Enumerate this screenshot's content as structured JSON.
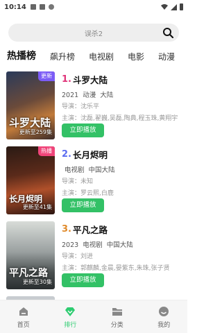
{
  "status": {
    "time": "10:14"
  },
  "search": {
    "placeholder": "误杀2"
  },
  "tabs": [
    "热播榜",
    "飙升榜",
    "电视剧",
    "电影",
    "动漫",
    "综"
  ],
  "items": [
    {
      "rank": "1.",
      "rank_color": "#e0357a",
      "title": "斗罗大陆",
      "meta": [
        "2021",
        "动漫",
        "大陆"
      ],
      "director": "导演：沈乐平",
      "cast": "主演：沈磊,翟巍,吴磊,陶典,程玉珠,黄翔宇",
      "badge": "更新",
      "badge_color": "#7c5cf6",
      "poster_title": "斗罗大陆",
      "update": "更新至259集",
      "play": "立即播放"
    },
    {
      "rank": "2.",
      "rank_color": "#5b6cf0",
      "title": "长月烬明",
      "meta": [
        "电视剧",
        "中国大陆"
      ],
      "director": "导演：未知",
      "cast": "主演：罗云熙,白鹿",
      "badge": "热播",
      "badge_color": "#f0457a",
      "poster_title": "长月烬明",
      "update": "更新至41集",
      "play": "立即播放"
    },
    {
      "rank": "3.",
      "rank_color": "#e08a2b",
      "title": "平凡之路",
      "meta": [
        "2023",
        "电视剧",
        "中国大陆"
      ],
      "director": "导演：刘进",
      "cast": "主演：郭麒麟,金晨,晏紫东,朱珠,张子贤",
      "badge": "",
      "badge_color": "",
      "poster_title": "平凡之路",
      "update": "更新至30集",
      "play": "立即播放"
    }
  ],
  "nav": [
    "首页",
    "排行",
    "分类",
    "我的"
  ]
}
